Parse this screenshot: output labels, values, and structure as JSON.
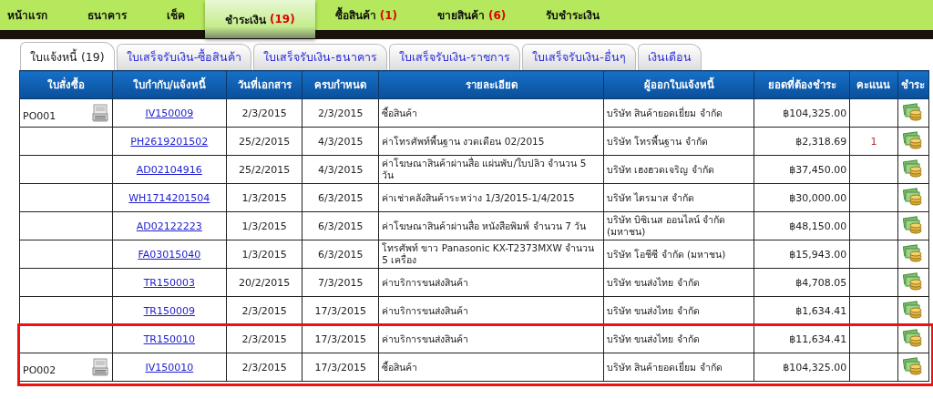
{
  "nav": [
    {
      "label": "หน้าแรก",
      "selected": false
    },
    {
      "label": "ธนาคาร",
      "selected": false
    },
    {
      "label": "เช็ค",
      "selected": false
    },
    {
      "label": "ชำระเงิน",
      "count": "(19)",
      "selected": true
    },
    {
      "label": "ซื้อสินค้า",
      "count": "(1)",
      "selected": false
    },
    {
      "label": "ขายสินค้า",
      "count": "(6)",
      "selected": false
    },
    {
      "label": "รับชำระเงิน",
      "selected": false
    }
  ],
  "tabs": [
    {
      "label": "ใบแจ้งหนี้ (19)",
      "selected": true
    },
    {
      "label": "ใบเสร็จรับเงิน-ซื้อสินค้า",
      "selected": false
    },
    {
      "label": "ใบเสร็จรับเงิน-ธนาคาร",
      "selected": false
    },
    {
      "label": "ใบเสร็จรับเงิน-ราชการ",
      "selected": false
    },
    {
      "label": "ใบเสร็จรับเงิน-อื่นๆ",
      "selected": false
    },
    {
      "label": "เงินเดือน",
      "selected": false
    }
  ],
  "table": {
    "columns": [
      "ใบสั่งซื้อ",
      "ใบกำกับ/แจ้งหนี้",
      "วันที่เอกสาร",
      "ครบกำหนด",
      "รายละเอียด",
      "ผู้ออกใบแจ้งหนี้",
      "ยอดที่ต้องชำระ",
      "คะแนน",
      "ชำระ"
    ],
    "rows": [
      {
        "po": "PO001",
        "invoice": "IV150009",
        "doc_date": "2/3/2015",
        "due": "2/3/2015",
        "detail": "ซื้อสินค้า",
        "issuer": "บริษัท สินค้ายอดเยี่ยม จำกัด",
        "amount": "฿104,325.00",
        "highlighted": false
      },
      {
        "invoice": "PH2619201502",
        "doc_date": "25/2/2015",
        "due": "4/3/2015",
        "detail": "ค่าโทรศัพท์พื้นฐาน งวดเดือน 02/2015",
        "issuer": "บริษัท โทรพื้นฐาน จำกัด",
        "amount": "฿2,318.69",
        "score": "1",
        "highlighted": false
      },
      {
        "invoice": "AD02104916",
        "doc_date": "25/2/2015",
        "due": "4/3/2015",
        "detail": "ค่าโฆษณาสินค้าผ่านสื่อ แผ่นพับ/ใบปลิว จำนวน 5 วัน",
        "issuer": "บริษัท เฮงฮวดเจริญ จำกัด",
        "amount": "฿37,450.00",
        "highlighted": false
      },
      {
        "invoice": "WH1714201504",
        "doc_date": "1/3/2015",
        "due": "6/3/2015",
        "detail": "ค่าเช่าคลังสินค้าระหว่าง 1/3/2015-1/4/2015",
        "issuer": "บริษัท ไตรมาส จำกัด",
        "amount": "฿30,000.00",
        "highlighted": false
      },
      {
        "invoice": "AD02122223",
        "doc_date": "1/3/2015",
        "due": "6/3/2015",
        "detail": "ค่าโฆษณาสินค้าผ่านสื่อ หนังสือพิมพ์ จำนวน 7 วัน",
        "issuer": "บริษัท บิซิเนส ออนไลน์ จำกัด (มหาชน)",
        "amount": "฿48,150.00",
        "highlighted": false
      },
      {
        "invoice": "FA03015040",
        "doc_date": "1/3/2015",
        "due": "6/3/2015",
        "detail": "โทรศัพท์ ขาว Panasonic KX-T2373MXW จำนวน 5 เครื่อง",
        "issuer": "บริษัท โอชีซี จำกัด (มหาชน)",
        "amount": "฿15,943.00",
        "highlighted": false
      },
      {
        "invoice": "TR150003",
        "doc_date": "20/2/2015",
        "due": "7/3/2015",
        "detail": "ค่าบริการขนส่งสินค้า",
        "issuer": "บริษัท ขนส่งไทย จำกัด",
        "amount": "฿4,708.05",
        "highlighted": false
      },
      {
        "invoice": "TR150009",
        "doc_date": "2/3/2015",
        "due": "17/3/2015",
        "detail": "ค่าบริการขนส่งสินค้า",
        "issuer": "บริษัท ขนส่งไทย จำกัด",
        "amount": "฿1,634.41",
        "highlighted": false
      },
      {
        "invoice": "TR150010",
        "doc_date": "2/3/2015",
        "due": "17/3/2015",
        "detail": "ค่าบริการขนส่งสินค้า",
        "issuer": "บริษัท ขนส่งไทย จำกัด",
        "amount": "฿11,634.41",
        "highlighted": true
      },
      {
        "po": "PO002",
        "invoice": "IV150010",
        "doc_date": "2/3/2015",
        "due": "17/3/2015",
        "detail": "ซื้อสินค้า",
        "issuer": "บริษัท สินค้ายอดเยี่ยม จำกัด",
        "amount": "฿104,325.00",
        "highlighted": true
      }
    ]
  }
}
